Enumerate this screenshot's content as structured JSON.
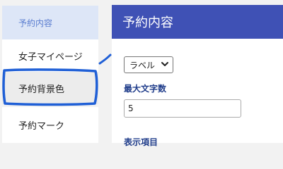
{
  "sidebar": {
    "items": [
      {
        "label": "予約内容"
      },
      {
        "label": "女子マイページ"
      },
      {
        "label": "予約背景色"
      },
      {
        "label": "予約マーク"
      }
    ]
  },
  "main": {
    "title": "予約内容",
    "select": {
      "value": "ラベル"
    },
    "max_chars": {
      "label": "最大文字数",
      "value": "5"
    },
    "display_items": {
      "label": "表示項目"
    }
  },
  "colors": {
    "header": "#3f51b5",
    "active_bg": "#dde6f7",
    "annotation": "#1f5fd6"
  }
}
